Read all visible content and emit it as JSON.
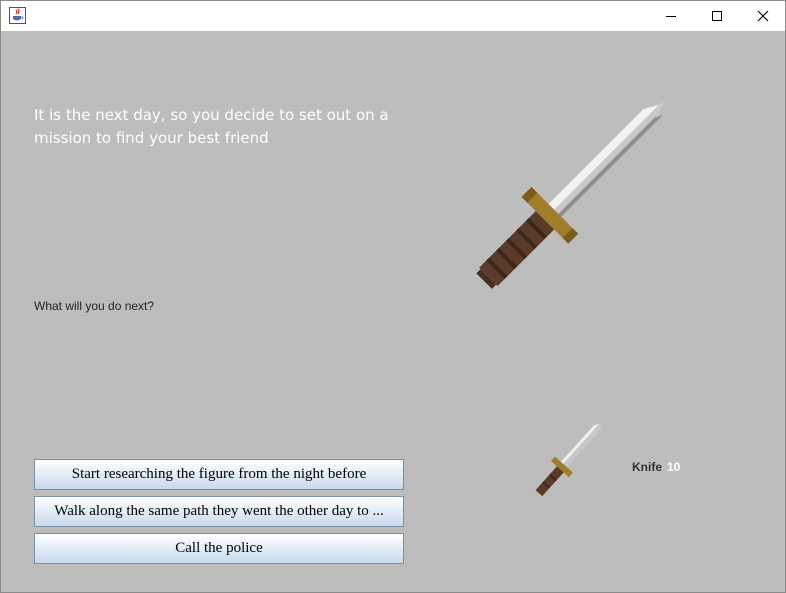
{
  "window": {
    "app_icon": "java-cup-icon",
    "controls": {
      "minimize": "minimize-icon",
      "maximize": "maximize-icon",
      "close": "close-icon"
    }
  },
  "story": {
    "text": "It is the next day, so you decide to set out on a mission to find your best friend",
    "prompt": "What will you do next?"
  },
  "scene_image": "knife-icon",
  "inventory": {
    "item_name": "Knife",
    "item_count": "10",
    "item_icon": "knife-icon"
  },
  "choices": [
    {
      "label": "Start researching the figure from the night before"
    },
    {
      "label": "Walk along the same path they went the other day to ..."
    },
    {
      "label": "Call the police"
    }
  ],
  "colors": {
    "background": "#bdbdbd",
    "story_text": "#ffffff",
    "blade": "#c8c8c8",
    "guard": "#a07d2a",
    "handle": "#5a3a28"
  }
}
